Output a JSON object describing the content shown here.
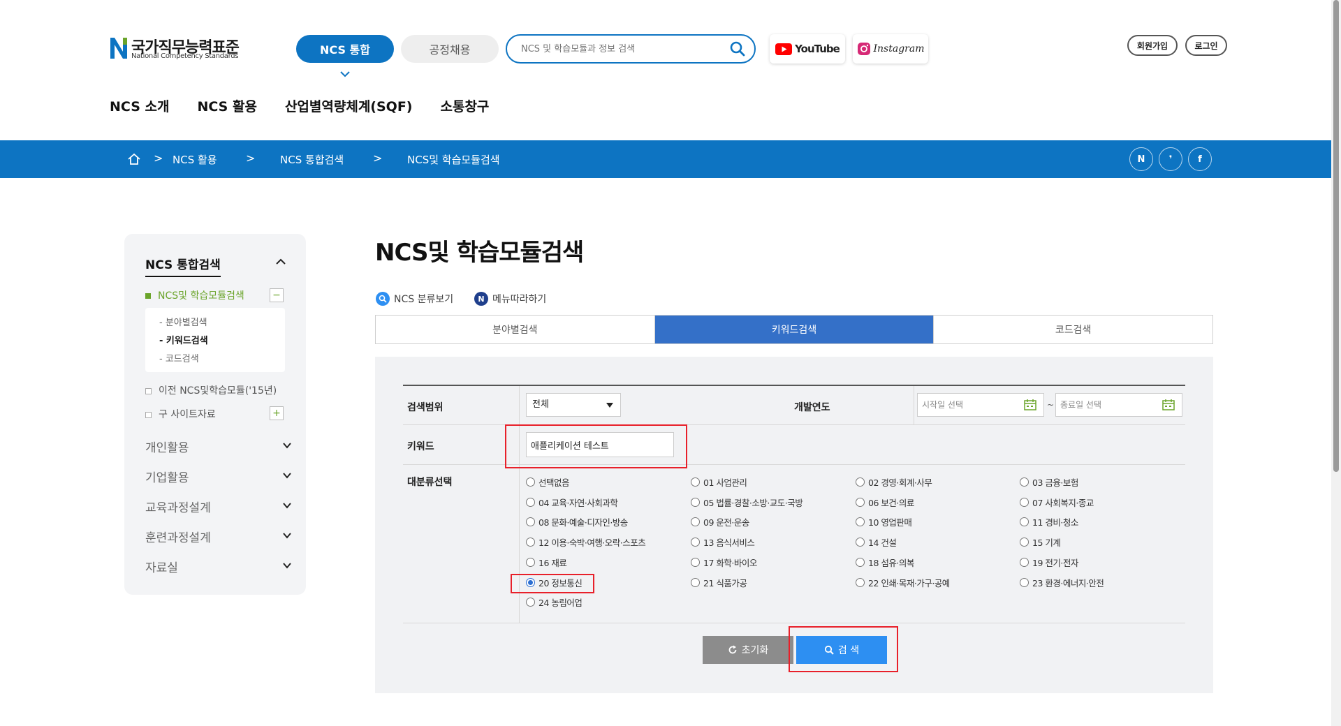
{
  "header": {
    "logo_ko": "국가직무능력표준",
    "logo_en": "National Competency Standards",
    "btn_ncs": "NCS 통합",
    "btn_job": "공정채용",
    "search_placeholder": "NCS 및 학습모듈과 정보 검색",
    "youtube": "YouTube",
    "instagram": "Instagram",
    "join": "회원가입",
    "login": "로그인",
    "gnb": [
      "NCS 소개",
      "NCS 활용",
      "산업별역량체계(SQF)",
      "소통창구"
    ]
  },
  "breadcrumb": {
    "items": [
      "NCS 활용",
      "NCS 통합검색",
      "NCS및 학습모듈검색"
    ],
    "sep": ">",
    "social": [
      "N",
      "❜",
      "f"
    ]
  },
  "sidebar": {
    "title": "NCS 통합검색",
    "active": "NCS및 학습모듈검색",
    "sub": [
      "- 분야별검색",
      "- 키워드검색",
      "- 코드검색"
    ],
    "items": [
      "이전 NCS및학습모듈('15년)",
      "구 사이트자료"
    ],
    "menus": [
      "개인활용",
      "기업활용",
      "교육과정설계",
      "훈련과정설계",
      "자료실"
    ]
  },
  "main": {
    "title": "NCS및 학습모듈검색",
    "link_tree": "NCS 분류보기",
    "link_follow": "메뉴따라하기",
    "tabs": [
      "분야별검색",
      "키워드검색",
      "코드검색"
    ]
  },
  "form": {
    "scope_label": "검색범위",
    "scope_value": "전체",
    "year_label": "개발연도",
    "start_placeholder": "시작일 선택",
    "tilde": "~",
    "end_placeholder": "종료일 선택",
    "keyword_label": "키워드",
    "keyword_value": "애플리케이션 테스트",
    "category_label": "대분류선택",
    "categories": [
      "선택없음",
      "01 사업관리",
      "02 경영·회계·사무",
      "03 금융·보험",
      "04 교육·자연·사회과학",
      "05 법률·경찰·소방·교도·국방",
      "06 보건·의료",
      "07 사회복지·종교",
      "08 문화·예술·디자인·방송",
      "09 운전·운송",
      "10 영업판매",
      "11 경비·청소",
      "12 이용·숙박·여행·오락·스포츠",
      "13 음식서비스",
      "14 건설",
      "15 기계",
      "16 재료",
      "17 화학·바이오",
      "18 섬유·의복",
      "19 전기·전자",
      "20 정보통신",
      "21 식품가공",
      "22 인쇄·목재·가구·공예",
      "23 환경·에너지·안전",
      "24 농림어업"
    ],
    "selected_category": "20 정보통신",
    "reset_label": "초기화",
    "search_label": "검 색"
  },
  "colors": {
    "brand_blue": "#0d74c2",
    "tab_active": "#3470c8",
    "search_button": "#2d8ff2",
    "reset_button": "#8c8c8c",
    "sidebar_active": "#6aa42a",
    "highlight": "#e8202a"
  },
  "icons": [
    "home-icon",
    "search-icon",
    "calendar-icon",
    "refresh-icon",
    "chevron-down-icon",
    "chevron-up-icon"
  ]
}
